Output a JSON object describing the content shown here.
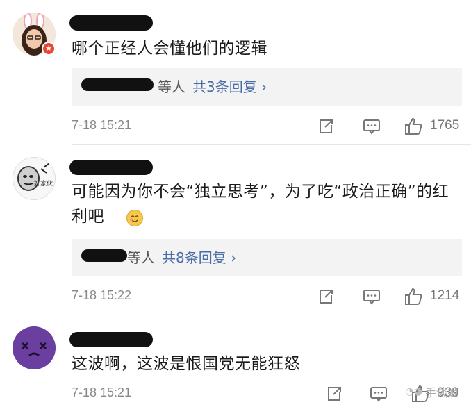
{
  "comments": [
    {
      "text": "哪个正经人会懂他们的逻辑",
      "replies": {
        "who": "等人",
        "count": "共3条回复 ›"
      },
      "time": "7-18 15:21",
      "likes": "1765"
    },
    {
      "text": "可能因为你不会“独立思考”，为了吃“政治正确”的红利吧",
      "avatar_badge": "好家伙",
      "replies": {
        "who": "等人",
        "count": "共8条回复 ›"
      },
      "time": "7-18 15:22",
      "likes": "1214"
    },
    {
      "text": "这波啊，这波是恨国党无能狂怒",
      "time": "7-18 15:21",
      "likes": "939"
    }
  ],
  "watermark": "手谈姬",
  "colors": {
    "link": "#4a6ea8",
    "meta": "#888888",
    "reply_bg": "#f3f3f3"
  }
}
